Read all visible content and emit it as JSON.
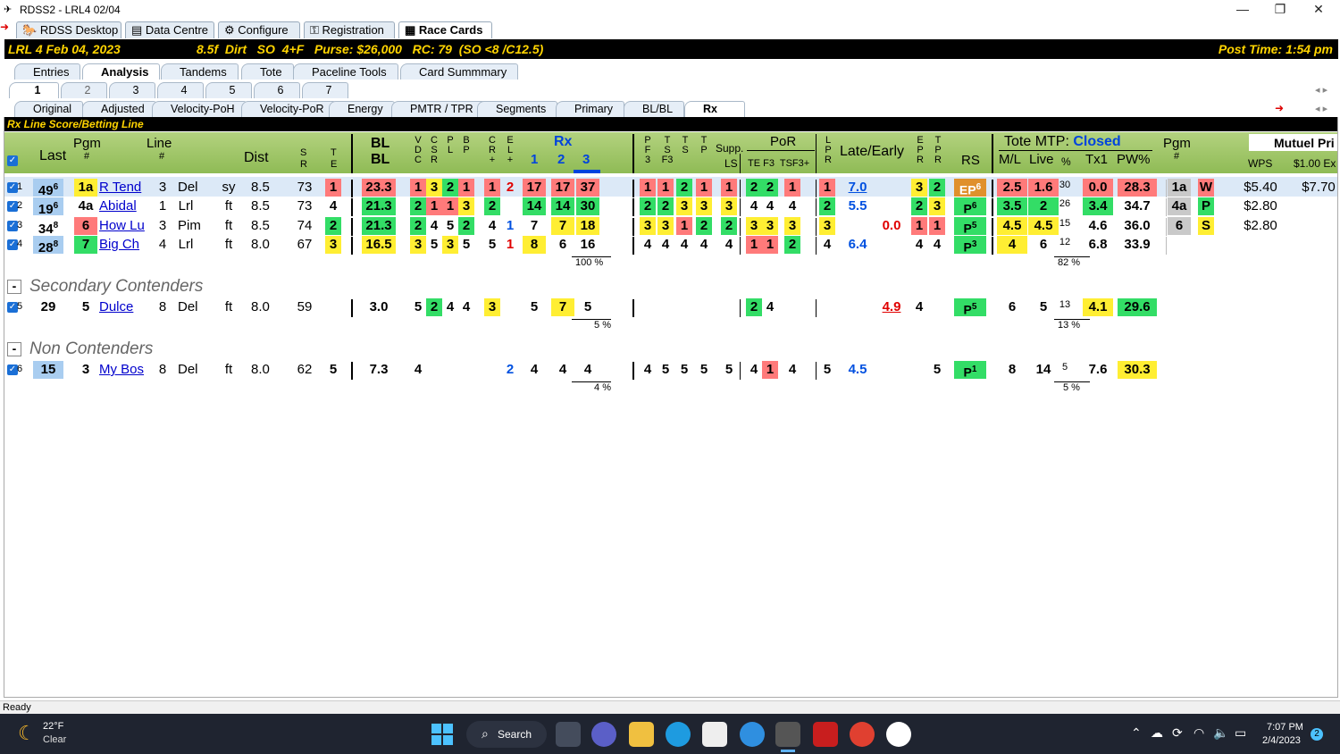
{
  "window": {
    "title": "RDSS2 - LRL4 02/04"
  },
  "main_tabs": [
    "RDSS Desktop",
    "Data Centre",
    "Configure",
    "Registration",
    "Race Cards"
  ],
  "race_bar": {
    "left": "LRL  4  Feb 04, 2023",
    "mid": "8.5f  Dirt   SO  4+F   Purse: $26,000   RC: 79  (SO <8 /C12.5)",
    "post": "Post Time: 1:54 pm"
  },
  "analysis_tabs": [
    "Entries",
    "Analysis",
    "Tandems",
    "Tote",
    "Paceline Tools",
    "Card Summmary"
  ],
  "race_tabs": [
    "1",
    "2",
    "3",
    "4",
    "5",
    "6",
    "7"
  ],
  "sub_tabs": [
    "Original",
    "Adjusted",
    "Velocity-PoH",
    "Velocity-PoR",
    "Energy",
    "PMTR / TPR",
    "Segments",
    "Primary",
    "BL/BL",
    "Rx"
  ],
  "section_title": "Rx Line Score/Betting Line",
  "headers": {
    "last": "Last",
    "pgm": "Pgm",
    "pgm_hash": "#",
    "line": "Line",
    "line_hash": "#",
    "dist": "Dist",
    "s": "S",
    "r": "R",
    "t": "T",
    "e": "E",
    "bl1": "BL",
    "bl2": "BL",
    "vdc": [
      "V",
      "D",
      "C"
    ],
    "csr": [
      "C",
      "S",
      "R"
    ],
    "pl": [
      "P",
      "L"
    ],
    "bp": [
      "B",
      "P"
    ],
    "cr": [
      "C",
      "R",
      "+"
    ],
    "el": [
      "E",
      "L",
      "+"
    ],
    "rx": "Rx",
    "rx1": "1",
    "rx2": "2",
    "rx3": "3",
    "pf3": [
      "P",
      "F",
      "3"
    ],
    "tsf3": [
      "T",
      "S",
      "F3"
    ],
    "ts": [
      "T",
      "S"
    ],
    "tp": [
      "T",
      "P"
    ],
    "supp": "Supp.",
    "ls": "LS",
    "por": "PoR",
    "por_sub": "TE F3  TSF3+",
    "lpr": [
      "L",
      "P",
      "R"
    ],
    "late_early": "Late/Early",
    "epr": [
      "E",
      "P",
      "R"
    ],
    "tpr": [
      "T",
      "P",
      "R"
    ],
    "rs": "RS",
    "tote": "Tote MTP:",
    "closed": "Closed",
    "ml": "M/L",
    "live": "Live",
    "pct": "%",
    "tx1": "Tx1",
    "pw": "PW%",
    "pgm2": "Pgm",
    "pgm2_hash": "#",
    "mutuel": "Mutuel Pri",
    "wps": "WPS",
    "ex": "$1.00 Ex"
  },
  "groups": {
    "secondary": "Secondary Contenders",
    "non": "Non Contenders"
  },
  "rows": [
    {
      "n": "1",
      "last": "49",
      "lsup": "6",
      "pgm": "1a",
      "name": "R Tend",
      "line": "3",
      "trk": "Del",
      "cond": "sy",
      "dist": "8.5",
      "sr": "73",
      "te": "1",
      "bl": "23.3",
      "v": "1",
      "c": "3",
      "p": "2",
      "b": "1",
      "cr": "1",
      "el": "2",
      "rx1": "17",
      "rx2": "17",
      "rx3": "37",
      "pf": "1",
      "ts1": "1",
      "ts2": "2",
      "tp": "1",
      "ls": "1",
      "te2": "2",
      "f3": "2",
      "tsf": "1",
      "lpr": "1",
      "le": "7.0",
      "le2": "",
      "e": "3",
      "t": "2",
      "rs": "EP",
      "rssup": "6",
      "ml": "2.5",
      "live": "1.6",
      "pct": "30",
      "tx1": "0.0",
      "pw": "28.3",
      "pgm2": "1a",
      "pos": "W",
      "wps": "$5.40",
      "ex": "$7.70"
    },
    {
      "n": "2",
      "last": "19",
      "lsup": "6",
      "pgm": "4a",
      "name": "Abidal",
      "line": "1",
      "trk": "Lrl",
      "cond": "ft",
      "dist": "8.5",
      "sr": "73",
      "te": "4",
      "bl": "21.3",
      "v": "2",
      "c": "1",
      "p": "1",
      "b": "3",
      "cr": "2",
      "el": "",
      "rx1": "14",
      "rx2": "14",
      "rx3": "30",
      "pf": "2",
      "ts1": "2",
      "ts2": "3",
      "tp": "3",
      "ls": "3",
      "te2": "4",
      "f3": "4",
      "tsf": "4",
      "lpr": "2",
      "le": "5.5",
      "le2": "",
      "e": "2",
      "t": "3",
      "rs": "P",
      "rssup": "6",
      "ml": "3.5",
      "live": "2",
      "pct": "26",
      "tx1": "3.4",
      "pw": "34.7",
      "pgm2": "4a",
      "pos": "P",
      "wps": "$2.80",
      "ex": ""
    },
    {
      "n": "3",
      "last": "34",
      "lsup": "8",
      "pgm": "6",
      "name": "How Lu",
      "line": "3",
      "trk": "Pim",
      "cond": "ft",
      "dist": "8.5",
      "sr": "74",
      "te": "2",
      "bl": "21.3",
      "v": "2",
      "c": "4",
      "p": "5",
      "b": "2",
      "cr": "4",
      "el": "1",
      "rx1": "7",
      "rx2": "7",
      "rx3": "18",
      "pf": "3",
      "ts1": "3",
      "ts2": "1",
      "tp": "2",
      "ls": "2",
      "te2": "3",
      "f3": "3",
      "tsf": "3",
      "lpr": "3",
      "le": "",
      "le2": "0.0",
      "e": "1",
      "t": "1",
      "rs": "P",
      "rssup": "5",
      "ml": "4.5",
      "live": "4.5",
      "pct": "15",
      "tx1": "4.6",
      "pw": "36.0",
      "pgm2": "6",
      "pos": "S",
      "wps": "$2.80",
      "ex": ""
    },
    {
      "n": "4",
      "last": "28",
      "lsup": "8",
      "pgm": "7",
      "name": "Big Ch",
      "line": "4",
      "trk": "Lrl",
      "cond": "ft",
      "dist": "8.0",
      "sr": "67",
      "te": "3",
      "bl": "16.5",
      "v": "3",
      "c": "5",
      "p": "3",
      "b": "5",
      "cr": "5",
      "el": "1",
      "rx1": "8",
      "rx2": "6",
      "rx3": "16",
      "pf": "4",
      "ts1": "4",
      "ts2": "4",
      "tp": "4",
      "ls": "4",
      "te2": "1",
      "f3": "1",
      "tsf": "2",
      "lpr": "4",
      "le": "6.4",
      "le2": "",
      "e": "4",
      "t": "4",
      "rs": "P",
      "rssup": "3",
      "ml": "4",
      "live": "6",
      "pct": "12",
      "tx1": "6.8",
      "pw": "33.9",
      "pgm2": "",
      "pos": "",
      "wps": "",
      "ex": ""
    },
    {
      "n": "5",
      "last": "29",
      "lsup": "",
      "pgm": "5",
      "name": "Dulce",
      "line": "8",
      "trk": "Del",
      "cond": "ft",
      "dist": "8.0",
      "sr": "59",
      "te": "",
      "bl": "3.0",
      "v": "5",
      "c": "2",
      "p": "4",
      "b": "4",
      "cr": "3",
      "el": "",
      "rx1": "5",
      "rx2": "7",
      "rx3": "5",
      "pf": "",
      "ts1": "",
      "ts2": "",
      "tp": "",
      "ls": "",
      "te2": "2",
      "f3": "4",
      "tsf": "",
      "lpr": "",
      "le": "",
      "le2": "4.9",
      "e": "4",
      "t": "",
      "rs": "P",
      "rssup": "5",
      "ml": "6",
      "live": "5",
      "pct": "13",
      "tx1": "4.1",
      "pw": "29.6",
      "pgm2": "",
      "pos": "",
      "wps": "",
      "ex": ""
    },
    {
      "n": "6",
      "last": "15",
      "lsup": "",
      "pgm": "3",
      "name": "My Bos",
      "line": "8",
      "trk": "Del",
      "cond": "ft",
      "dist": "8.0",
      "sr": "62",
      "te": "5",
      "bl": "7.3",
      "v": "4",
      "c": "",
      "p": "",
      "b": "",
      "cr": "",
      "el": "2",
      "rx1": "4",
      "rx2": "4",
      "rx3": "4",
      "pf": "4",
      "ts1": "5",
      "ts2": "5",
      "tp": "5",
      "ls": "5",
      "te2": "4",
      "f3": "1",
      "tsf": "4",
      "lpr": "5",
      "le": "4.5",
      "le2": "",
      "e": "",
      "t": "5",
      "rs": "P",
      "rssup": "1",
      "ml": "8",
      "live": "14",
      "pct": "5",
      "tx1": "7.6",
      "pw": "30.3",
      "pgm2": "",
      "pos": "",
      "wps": "",
      "ex": ""
    }
  ],
  "pct_rows": {
    "rx_main": "100 %",
    "tote_main": "82 %",
    "rx_sec": "5 %",
    "tote_sec": "13 %",
    "rx_non": "4 %",
    "tote_non": "5 %"
  },
  "status": "Ready",
  "taskbar": {
    "temp": "22°F",
    "weather": "Clear",
    "search": "Search",
    "time": "7:07 PM",
    "date": "2/4/2023",
    "badge": "2"
  }
}
